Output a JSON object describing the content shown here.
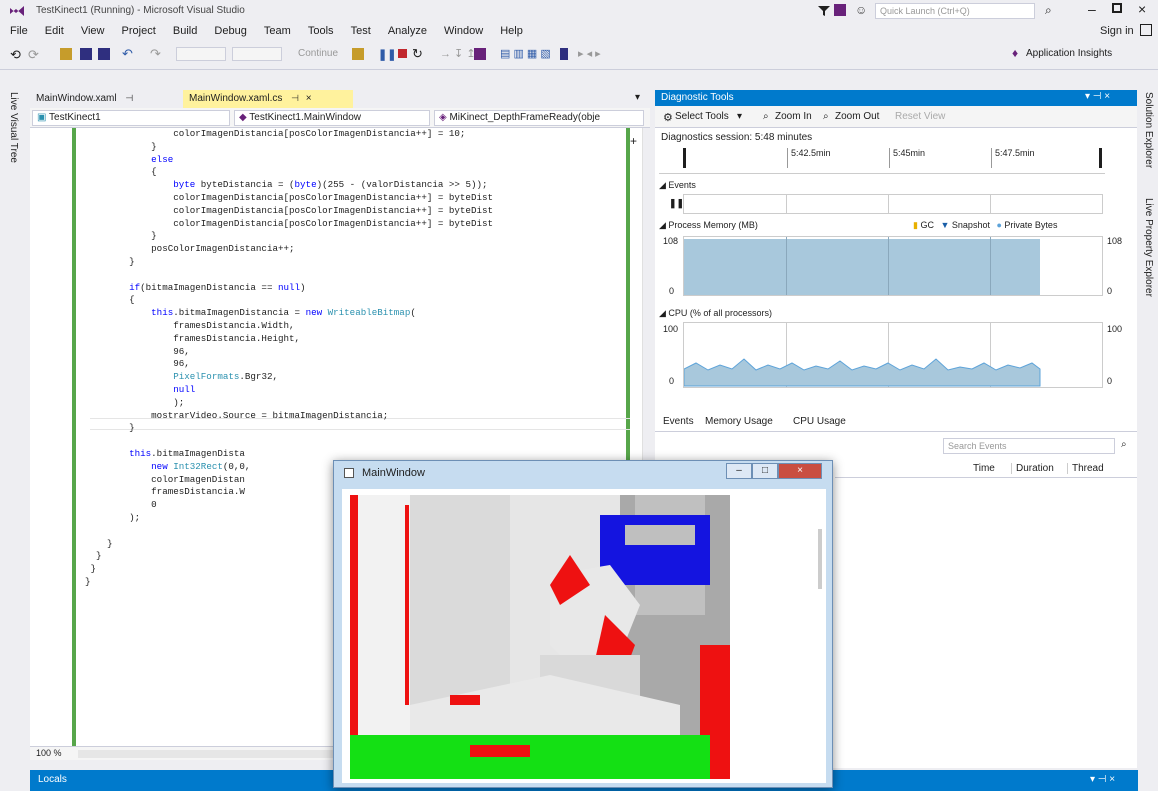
{
  "window": {
    "title": "TestKinect1 (Running) - Microsoft Visual Studio",
    "quick_launch": "Quick Launch (Ctrl+Q)",
    "sign_in": "Sign in"
  },
  "menu": [
    "File",
    "Edit",
    "View",
    "Project",
    "Build",
    "Debug",
    "Team",
    "Tools",
    "Test",
    "Analyze",
    "Window",
    "Help"
  ],
  "toolbar": {
    "continue": "Continue",
    "app_insights": "Application Insights"
  },
  "side_tabs": {
    "left": "Live Visual Tree",
    "right1": "Solution Explorer",
    "right2": "Live Property Explorer"
  },
  "doc_tabs": [
    {
      "label": "MainWindow.xaml"
    },
    {
      "label": "MainWindow.xaml.cs"
    }
  ],
  "nav": {
    "project": "TestKinect1",
    "class": "TestKinect1.MainWindow",
    "member": "MiKinect_DepthFrameReady(obje"
  },
  "code_lines": [
    "                colorImagenDistancia[posColorImagenDistancia++] = 10;",
    "            }",
    "            else",
    "            {",
    "                byte byteDistancia = (byte)(255 - (valorDistancia >> 5));",
    "                colorImagenDistancia[posColorImagenDistancia++] = byteDist",
    "                colorImagenDistancia[posColorImagenDistancia++] = byteDist",
    "                colorImagenDistancia[posColorImagenDistancia++] = byteDist",
    "            }",
    "            posColorImagenDistancia++;",
    "        }",
    "",
    "        if(bitmaImagenDistancia == null)",
    "        {",
    "            this.bitmaImagenDistancia = new WriteableBitmap(",
    "                framesDistancia.Width,",
    "                framesDistancia.Height,",
    "                96,",
    "                96,",
    "                PixelFormats.Bgr32,",
    "                null",
    "                );",
    "            mostrarVideo.Source = bitmaImagenDistancia;",
    "        }",
    "",
    "        this.bitmaImagenDista",
    "            new Int32Rect(0,0,",
    "            colorImagenDistan",
    "            framesDistancia.W",
    "            0",
    "        );",
    "",
    "    }",
    "  }",
    " }",
    "}"
  ],
  "zoom": "100 %",
  "diagnostic": {
    "title": "Diagnostic Tools",
    "select_tools": "Select Tools",
    "zoom_in": "Zoom In",
    "zoom_out": "Zoom Out",
    "reset_view": "Reset View",
    "session": "Diagnostics session: 5:48 minutes",
    "ticks": [
      "5:42.5min",
      "5:45min",
      "5:47.5min"
    ],
    "events_label": "Events",
    "memory_label": "Process Memory (MB)",
    "legend_gc": "GC",
    "legend_snapshot": "Snapshot",
    "legend_private": "Private Bytes",
    "mem_max": "108",
    "mem_min": "0",
    "cpu_label": "CPU (% of all processors)",
    "cpu_max": "100",
    "cpu_min": "0",
    "tabs": [
      "Events",
      "Memory Usage",
      "CPU Usage"
    ],
    "search_placeholder": "Search Events",
    "columns": [
      "Time",
      "Duration",
      "Thread"
    ]
  },
  "bottom_panel": {
    "title": "Locals"
  },
  "kinect_window": {
    "title": "MainWindow"
  }
}
